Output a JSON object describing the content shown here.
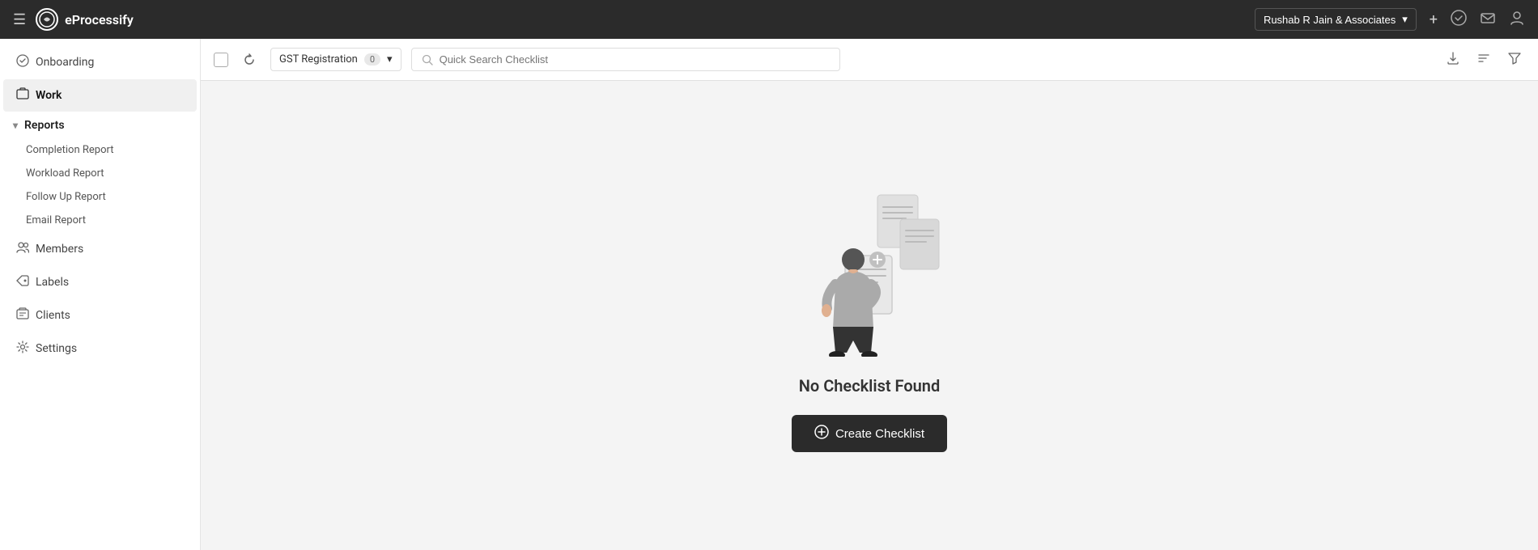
{
  "topnav": {
    "brand_name": "eProcessify",
    "org_name": "Rushab R Jain & Associates",
    "hamburger_label": "☰",
    "add_icon": "+",
    "check_icon": "✓",
    "mail_icon": "✉",
    "user_icon": "👤",
    "chevron_icon": "▾"
  },
  "sidebar": {
    "onboarding_label": "Onboarding",
    "work_label": "Work",
    "reports_label": "Reports",
    "reports_sub": [
      {
        "label": "Completion Report"
      },
      {
        "label": "Workload Report"
      },
      {
        "label": "Follow Up Report"
      },
      {
        "label": "Email Report"
      }
    ],
    "members_label": "Members",
    "labels_label": "Labels",
    "clients_label": "Clients",
    "settings_label": "Settings"
  },
  "toolbar": {
    "dropdown_label": "GST Registration",
    "badge_count": "0",
    "search_placeholder": "Quick Search Checklist"
  },
  "main": {
    "empty_title": "No Checklist Found",
    "create_btn_label": "Create Checklist",
    "create_btn_icon": "⊕"
  }
}
